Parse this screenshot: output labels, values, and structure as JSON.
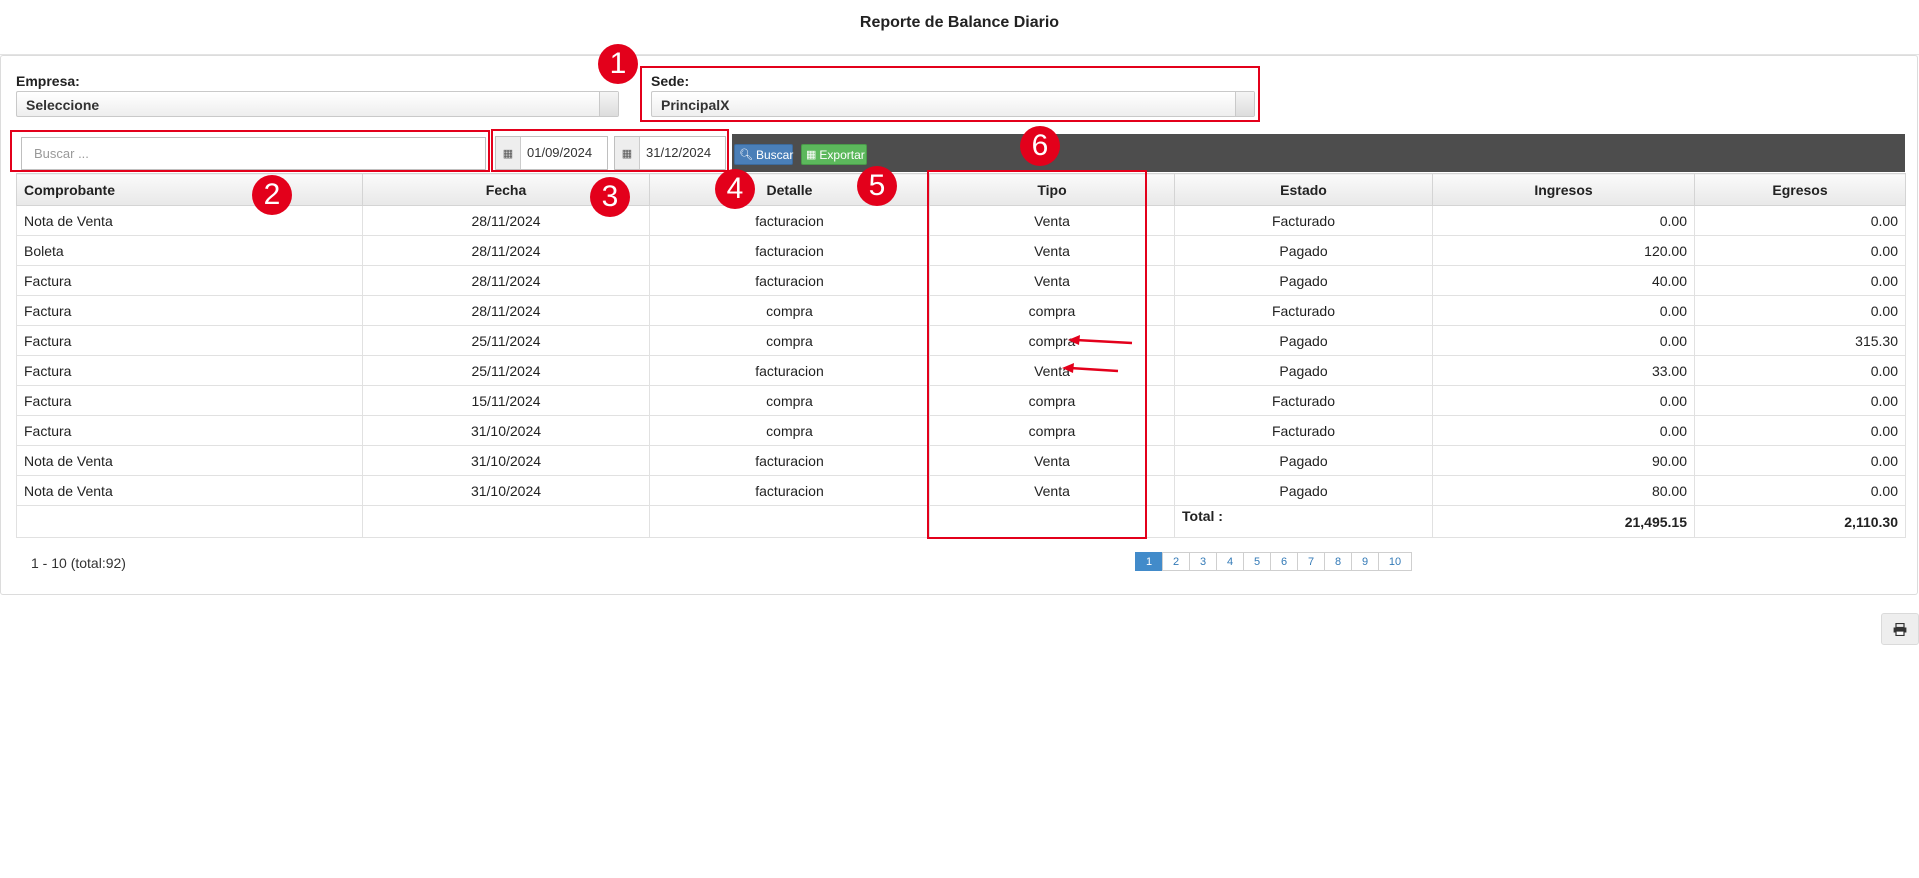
{
  "page": {
    "title": "Reporte de Balance Diario"
  },
  "filters": {
    "empresa_label": "Empresa:",
    "empresa_value": "Seleccione",
    "sede_label": "Sede:",
    "sede_value": "PrincipalX"
  },
  "toolbar": {
    "search_placeholder": "Buscar ...",
    "date_from": "01/09/2024",
    "date_to": "31/12/2024",
    "buscar_label": "Buscar",
    "exportar_label": "Exportar"
  },
  "table": {
    "headers": [
      "Comprobante",
      "Fecha",
      "Detalle",
      "Tipo",
      "Estado",
      "Ingresos",
      "Egresos"
    ],
    "rows": [
      [
        "Nota de Venta",
        "28/11/2024",
        "facturacion",
        "Venta",
        "Facturado",
        "0.00",
        "0.00"
      ],
      [
        "Boleta",
        "28/11/2024",
        "facturacion",
        "Venta",
        "Pagado",
        "120.00",
        "0.00"
      ],
      [
        "Factura",
        "28/11/2024",
        "facturacion",
        "Venta",
        "Pagado",
        "40.00",
        "0.00"
      ],
      [
        "Factura",
        "28/11/2024",
        "compra",
        "compra",
        "Facturado",
        "0.00",
        "0.00"
      ],
      [
        "Factura",
        "25/11/2024",
        "compra",
        "compra",
        "Pagado",
        "0.00",
        "315.30"
      ],
      [
        "Factura",
        "25/11/2024",
        "facturacion",
        "Venta",
        "Pagado",
        "33.00",
        "0.00"
      ],
      [
        "Factura",
        "15/11/2024",
        "compra",
        "compra",
        "Facturado",
        "0.00",
        "0.00"
      ],
      [
        "Factura",
        "31/10/2024",
        "compra",
        "compra",
        "Facturado",
        "0.00",
        "0.00"
      ],
      [
        "Nota de Venta",
        "31/10/2024",
        "facturacion",
        "Venta",
        "Pagado",
        "90.00",
        "0.00"
      ],
      [
        "Nota de Venta",
        "31/10/2024",
        "facturacion",
        "Venta",
        "Pagado",
        "80.00",
        "0.00"
      ]
    ],
    "total_label": "Total :",
    "total_ingresos": "21,495.15",
    "total_egresos": "2,110.30"
  },
  "pagination": {
    "info": "1 - 10 (total:92)",
    "pages": [
      "1",
      "2",
      "3",
      "4",
      "5",
      "6",
      "7",
      "8",
      "9",
      "10"
    ],
    "active": "1"
  },
  "annotations": [
    "1",
    "2",
    "3",
    "4",
    "5",
    "6"
  ],
  "colors": {
    "annotation": "#e3001b",
    "toolbar": "#4d4d4d",
    "buscar": "#4a7fb8",
    "exportar": "#5cb85c",
    "page_active": "#428bca"
  }
}
